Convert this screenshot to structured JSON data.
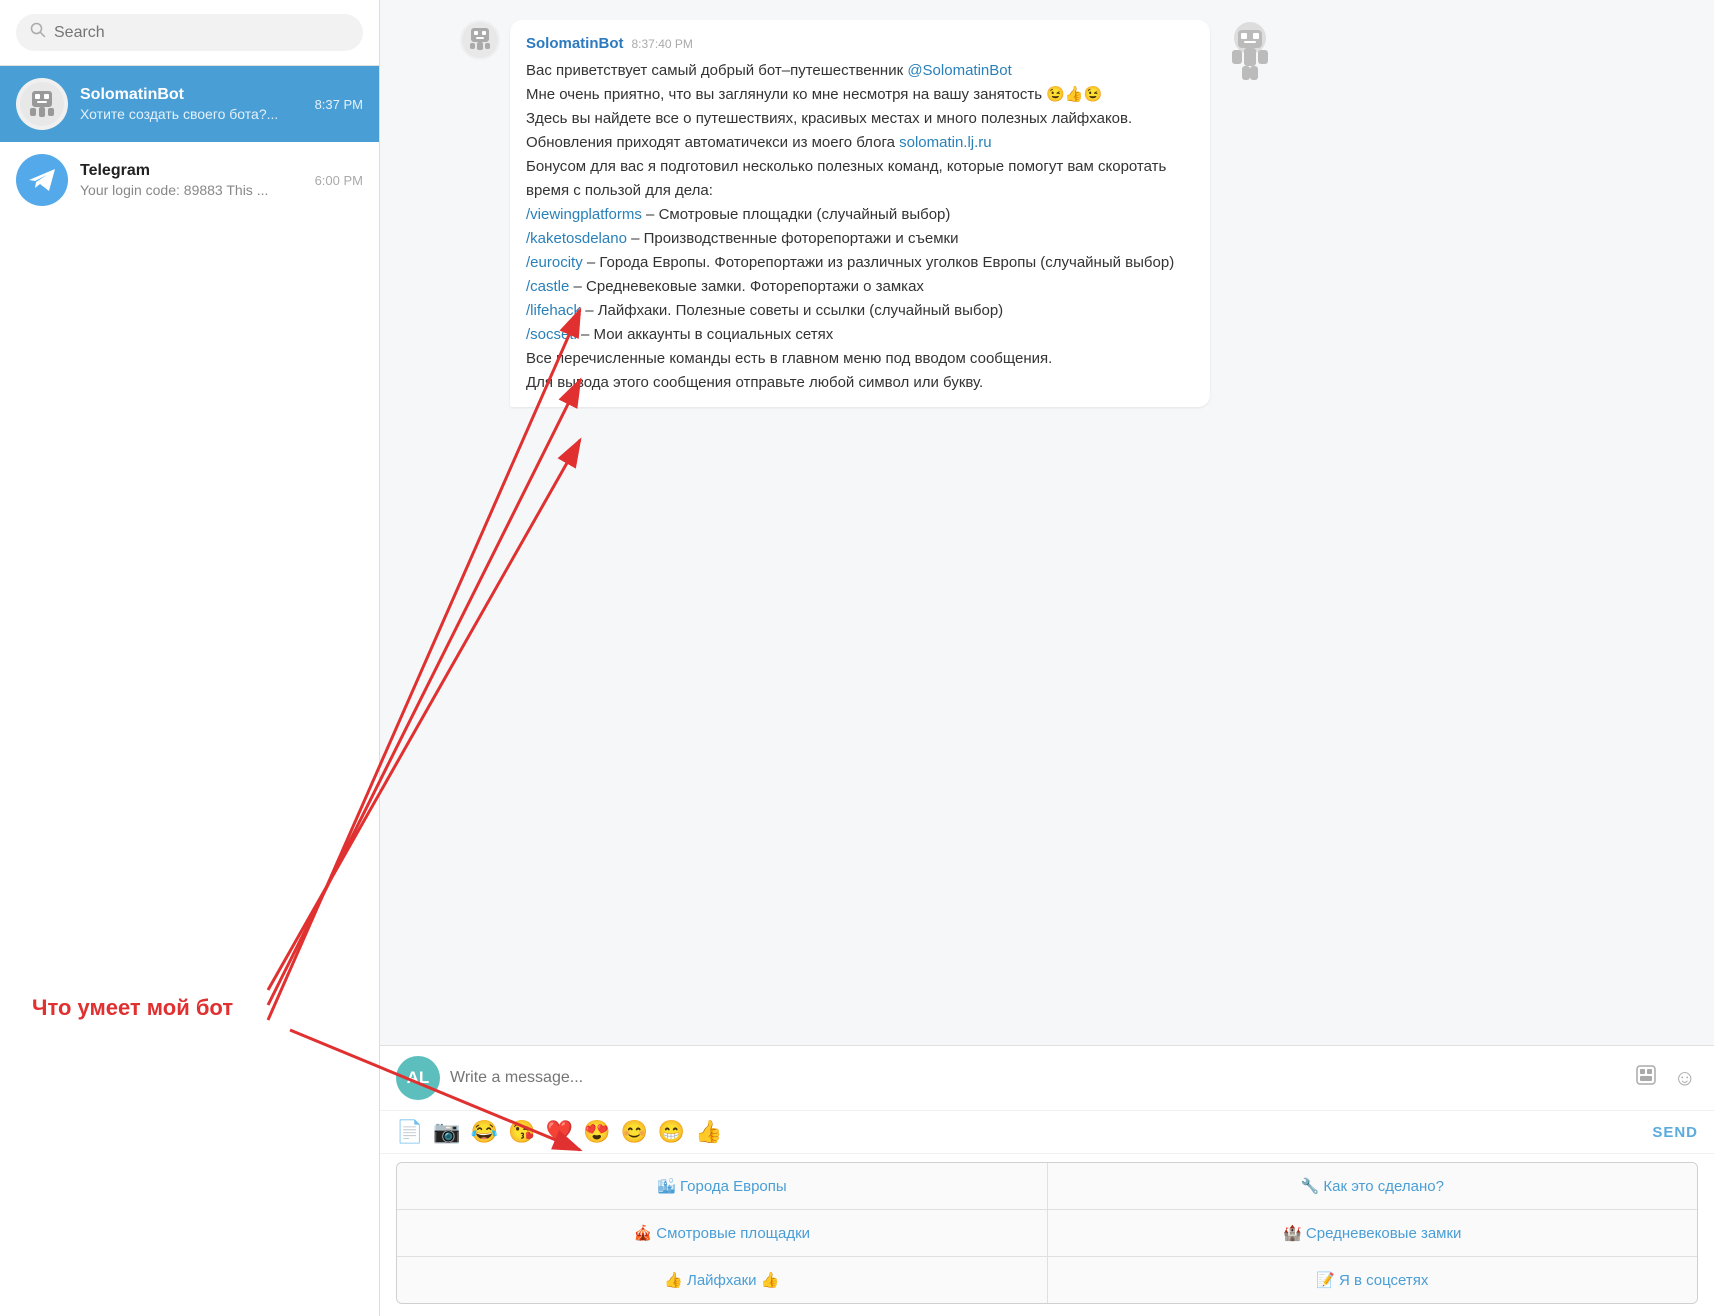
{
  "sidebar": {
    "search": {
      "placeholder": "Search"
    },
    "chats": [
      {
        "id": "solomatinbot",
        "name": "SolomatinBot",
        "preview": "Хотите создать своего бота?...",
        "time": "8:37 PM",
        "active": true,
        "avatarType": "bot"
      },
      {
        "id": "telegram",
        "name": "Telegram",
        "preview": "Your login code: 89883 This ...",
        "time": "6:00 PM",
        "active": false,
        "avatarType": "telegram"
      }
    ]
  },
  "chat": {
    "headerName": "SolomatinBot",
    "messages": [
      {
        "sender": "SolomatinBot",
        "time": "8:37:40 PM",
        "text": "Вас приветствует самый добрый бот–путешественник @SolomatinBot\nМне очень приятно, что вы заглянули ко мне несмотря на вашу занятость 😉👍😉\nЗдесь вы найдете все о путешествиях, красивых местах и много полезных лайфхаков. Обновления приходят автоматичекси из моего блога solomatin.lj.ru\nБонусом для вас я подготовил несколько полезных команд, которые помогут вам скоротать время с пользой для дела:",
        "commands": [
          {
            "cmd": "/viewingplatforms",
            "desc": "– Смотровые площадки (случайный выбор)"
          },
          {
            "cmd": "/kaketosdelano",
            "desc": "– Производственные фоторепортажи и съемки"
          },
          {
            "cmd": "/eurocity",
            "desc": "– Города Европы. Фоторепортажи из различных уголков Европы (случайный выбор)"
          },
          {
            "cmd": "/castle",
            "desc": "– Средневековые замки. Фоторепортажи о замках"
          },
          {
            "cmd": "/lifehack",
            "desc": "– Лайфхаки. Полезные советы и ссылки (случайный выбор)"
          },
          {
            "cmd": "/socseti",
            "desc": "– Мои аккаунты в социальных сетях"
          }
        ],
        "footer": "Все перечисленные команды есть в главном меню под вводом сообщения.\nДля вывода этого сообщения отправьте любой символ или букву."
      }
    ],
    "inputPlaceholder": "Write a message...",
    "userInitials": "AL",
    "sendLabel": "SEND",
    "keyboard": [
      [
        {
          "label": "🏙 Города Европы"
        },
        {
          "label": "🔧 Как это сделано?"
        }
      ],
      [
        {
          "label": "🎪 Смотровые площадки"
        },
        {
          "label": "🏰 Средневековые замки"
        }
      ],
      [
        {
          "label": "👍 Лайфхаки 👍"
        },
        {
          "label": "📝 Я в соцсетях"
        }
      ]
    ]
  },
  "annotation": {
    "text": "Что умеет мой бот"
  },
  "actionBar": {
    "icons": [
      "📄",
      "📷",
      "😂",
      "😘",
      "❤️",
      "😍",
      "😊",
      "😁",
      "👍"
    ]
  }
}
